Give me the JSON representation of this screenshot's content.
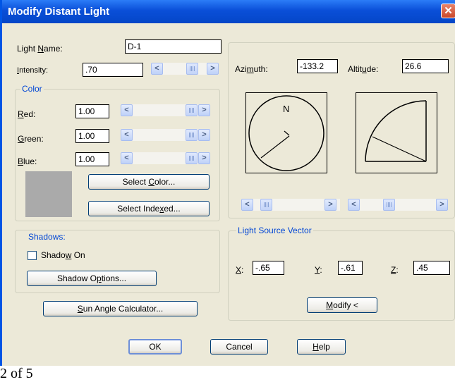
{
  "window": {
    "title": "Modify Distant Light",
    "close_icon": "close-icon"
  },
  "light_name": {
    "label": "Light Name:",
    "value": "D-1"
  },
  "intensity": {
    "label": "Intensity:",
    "value": ".70"
  },
  "color_group": {
    "title": "Color",
    "red": {
      "label": "Red:",
      "value": "1.00"
    },
    "green": {
      "label": "Green:",
      "value": "1.00"
    },
    "blue": {
      "label": "Blue:",
      "value": "1.00"
    },
    "swatch_color": "#aaaaaa",
    "select_color": "Select Color...",
    "select_indexed": "Select Indexed..."
  },
  "shadows_group": {
    "title": "Shadows:",
    "shadow_on": {
      "label": "Shadow On",
      "checked": false
    },
    "shadow_options": "Shadow Options..."
  },
  "sun_angle_calculator": "Sun Angle Calculator...",
  "azimuth": {
    "label": "Azimuth:",
    "value": "-133.2"
  },
  "altitude": {
    "label": "Altitude:",
    "value": "26.6"
  },
  "compass": {
    "north": "N"
  },
  "light_source_vector": {
    "title": "Light Source Vector",
    "x": {
      "label": "X:",
      "value": "-.65"
    },
    "y": {
      "label": "Y:",
      "value": "-.61"
    },
    "z": {
      "label": "Z:",
      "value": ".45"
    },
    "modify": "Modify <"
  },
  "buttons": {
    "ok": "OK",
    "cancel": "Cancel",
    "help": "Help"
  },
  "footer_text": "2 of 5"
}
